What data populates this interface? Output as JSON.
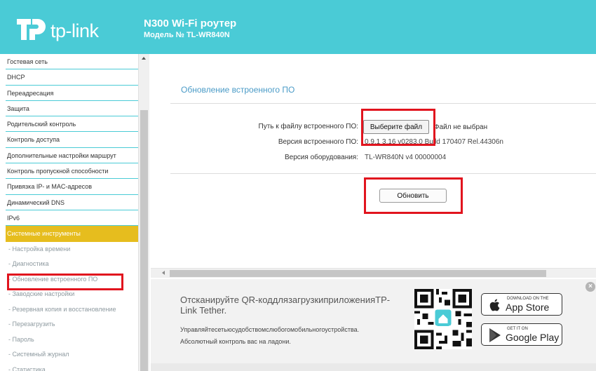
{
  "header": {
    "logo_text": "tp-link",
    "router_title": "N300 Wi-Fi роутер",
    "router_model": "Модель № TL-WR840N",
    "bg_color": "#4acbd6"
  },
  "sidebar": {
    "items": [
      {
        "label": "Гостевая сеть"
      },
      {
        "label": "DHCP"
      },
      {
        "label": "Переадресация"
      },
      {
        "label": "Защита"
      },
      {
        "label": "Родительский контроль"
      },
      {
        "label": "Контроль доступа"
      },
      {
        "label": "Дополнительные настройки маршрут"
      },
      {
        "label": "Контроль пропускной способности"
      },
      {
        "label": "Привязка IP- и MAC-адресов"
      },
      {
        "label": "Динамический DNS"
      },
      {
        "label": "IPv6"
      },
      {
        "label": "Системные инструменты"
      }
    ],
    "subitems": [
      {
        "label": "- Настройка времени"
      },
      {
        "label": "- Диагностика"
      },
      {
        "label": "- Обновление встроенного ПО"
      },
      {
        "label": "- Заводские настройки"
      },
      {
        "label": "- Резервная копия и восстановление"
      },
      {
        "label": "- Перезагрузить"
      },
      {
        "label": "- Пароль"
      },
      {
        "label": "- Системный журнал"
      },
      {
        "label": "- Статистика"
      }
    ],
    "active_color": "#e6bd1e"
  },
  "main": {
    "section_title": "Обновление встроенного ПО",
    "file_path_label": "Путь к файлу встроенного ПО:",
    "choose_file_button": "Выберите файл",
    "no_file_text": "Файл не выбран",
    "firmware_version_label": "Версия встроенного ПО:",
    "firmware_version_value": "0.9.1 3.16 v0283.0 Build 170407 Rel.44306n",
    "hardware_version_label": "Версия оборудования:",
    "hardware_version_value": "TL-WR840N v4 00000004",
    "update_button": "Обновить"
  },
  "promo": {
    "title": "Отсканируйте QR-коддлязагрузкиприложенияTP-Link Tether.",
    "desc_line1": "Управляйтесетьюсудобствомслюбогомобильногоустройства.",
    "desc_line2": "Абсолютный контроль вас на ладони.",
    "app_store_small": "DOWNLOAD ON THE",
    "app_store_big": "App Store",
    "google_play_small": "GET IT ON",
    "google_play_big": "Google Play",
    "close_symbol": "×"
  },
  "highlight_color": "#e1141e"
}
